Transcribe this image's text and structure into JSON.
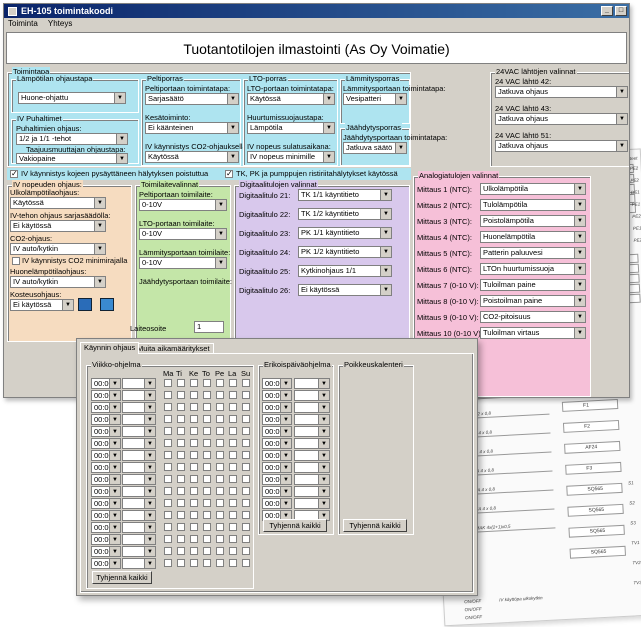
{
  "window": {
    "title": "EH-105 toimintakoodi"
  },
  "menu": [
    "Toiminta",
    "Yhteys"
  ],
  "banner": "Tuotantotilojen ilmastointi (As Oy Voimatie)",
  "toimintapa": {
    "title": "Toimintapa",
    "lampo": {
      "title": "Lämpötilan ohjaustapa",
      "value": "Huone-ohjattu"
    },
    "ivp": {
      "title": "IV Puhaltimet",
      "l1": "Puhaltimien ohjaus:",
      "v1": "1/2 ja 1/1 -tehot",
      "l2": "Taajuusmuuttajan ohjaustapa:",
      "v2": "Vakiopaine"
    },
    "pelti": {
      "title": "Peltiporras",
      "l1": "Peltiportaan toimintatapa:",
      "v1": "Sarjasäätö",
      "l2": "Kesätoiminto:",
      "v2": "Ei käänteinen",
      "l3": "IV käynnistys CO2-ohjauksella:",
      "v3": "Käytössä"
    },
    "lto": {
      "title": "LTO-porras",
      "l1": "LTO-portaan toimintatapa:",
      "v1": "Käytössä",
      "l2": "Huurtumissuojaustapa:",
      "v2": "Lämpötila",
      "l3": "IV nopeus sulatusaikana:",
      "v3": "IV nopeus minimille"
    },
    "lammitys": {
      "title": "Lämmitysporras",
      "l1": "Lämmitysportaan toimintatapa:",
      "v1": "Vesipatteri"
    },
    "jaahdytys": {
      "title": "Jäähdytysporras",
      "l1": "Jäähdytysportaan toimintatapa:",
      "v1": "Jatkuva säätö"
    },
    "check1": "IV käynnistys kojeen pysäyttäneen hälytyksen poistuttua",
    "check2": "TK, PK ja pumppujen ristiriitahälytykset käytössä"
  },
  "vac": {
    "title": "24VAC lähtöjen valinnat",
    "items": [
      {
        "label": "24 VAC lähtö 42:",
        "value": "Jatkuva ohjaus"
      },
      {
        "label": "24 VAC lähtö 43:",
        "value": "Jatkuva ohjaus"
      },
      {
        "label": "24 VAC lähtö 51:",
        "value": "Jatkuva ohjaus"
      }
    ]
  },
  "ivnop": {
    "title": "IV nopeuden ohjaus:",
    "l1": "Ulkolämpötilaohjaus:",
    "v1": "Käytössä",
    "l2": "IV-tehon ohjaus sarjasäädölla:",
    "v2": "Ei käytössä",
    "l3": "CO2-ohjaus:",
    "v3": "IV auto/kytkin",
    "c1": "IV käynnistys CO2 minimirajalla",
    "l4": "Huonelämpötilaohjaus:",
    "v4": "IV auto/kytkin",
    "l5": "Kosteusohjaus:",
    "v5": "Ei käytössä"
  },
  "toimilaite": {
    "title": "Toimilaitevalinnat",
    "items": [
      {
        "label": "Peltiportaan toimilaite:",
        "value": "0-10V"
      },
      {
        "label": "LTO-portaan toimilaite:",
        "value": "0-10V"
      },
      {
        "label": "Lämmitysportaan toimilaite:",
        "value": "0-10V"
      },
      {
        "label": "Jäähdytysportaan toimilaite:",
        "value": ""
      }
    ]
  },
  "digitaali": {
    "title": "Digitaalitulojen valinnat",
    "items": [
      {
        "label": "Digitaalitulo 21:",
        "value": "TK 1/1 käyntitieto"
      },
      {
        "label": "Digitaalitulo 22:",
        "value": "TK 1/2 käyntitieto"
      },
      {
        "label": "Digitaalitulo 23:",
        "value": "PK 1/1 käyntitieto"
      },
      {
        "label": "Digitaalitulo 24:",
        "value": "PK 1/2 käyntitieto"
      },
      {
        "label": "Digitaalitulo 25:",
        "value": "Kytkinohjaus 1/1"
      },
      {
        "label": "Digitaalitulo 26:",
        "value": "Ei käytössä"
      }
    ]
  },
  "analogia": {
    "title": "Analogiatulojen valinnat",
    "items": [
      {
        "label": "Mittaus 1 (NTC):",
        "value": "Ulkolämpötila"
      },
      {
        "label": "Mittaus 2 (NTC):",
        "value": "Tulolämpötila"
      },
      {
        "label": "Mittaus 3 (NTC):",
        "value": "Poistolämpötila"
      },
      {
        "label": "Mittaus 4 (NTC):",
        "value": "Huonelämpötila"
      },
      {
        "label": "Mittaus 5 (NTC):",
        "value": "Patterin paluuvesi"
      },
      {
        "label": "Mittaus 6 (NTC):",
        "value": "LTOn huurtumissuoja"
      },
      {
        "label": "Mittaus 7 (0-10 V):",
        "value": "Tuloilman paine"
      },
      {
        "label": "Mittaus 8 (0-10 V):",
        "value": "Poistoilman paine"
      },
      {
        "label": "Mittaus 9 (0-10 V):",
        "value": "CO2-pitoisuus"
      },
      {
        "label": "Mittaus 10 (0-10 V):",
        "value": "Tuloilman virtaus"
      }
    ]
  },
  "laiteosoite": {
    "label": "Laiteosoite",
    "value": "1"
  },
  "schedule": {
    "tabs": [
      "Käynnin ohjaus",
      "Muita aikamääritykset"
    ],
    "viikko": "Viikko-ohjelma",
    "days": [
      "Ma",
      "Ti",
      "Ke",
      "To",
      "Pe",
      "La",
      "Su"
    ],
    "time": "00:00",
    "erikois": "Erikoispäiväohjelma",
    "poikkeus": "Poikkeuskalenteri",
    "clear_all": "Tyhjennä kaikki",
    "clear": "Tyhjennä kaikki"
  },
  "sheet": {
    "header": "Kenttälaitteet",
    "codes": [
      "TMO",
      "TMO",
      "TMO",
      "TMO",
      "TMO",
      "PEL1000/N",
      "PEL1000/N",
      "SMH/25-N",
      "PEL1000",
      "PEL1000"
    ],
    "tags": [
      "PE2",
      "PE2",
      "DE1",
      "PE1",
      "PE2",
      "PE1",
      "PE2"
    ],
    "flm": [
      "FLMA 2 x 0,8",
      "FLMA 2 x 0,8",
      "FLMA 2 x 0,8",
      "FLMA 2 x 0,8",
      "FLMA 2 x 0,8",
      "FLMA 2 x 0,8",
      "FLMA 2 x 0,8",
      "FLMA 2 x 0,8",
      "FLMA 4 x 0,8",
      "FLMA 4 x 0,8",
      "FLMA 4 x 0,8",
      "FLMA 4 x 0,8",
      "FLMA 4 x 0,8",
      "JAMAK 4x(2+1)x0,5"
    ],
    "right": [
      "HS1",
      "HS2",
      "TF1",
      "TF2",
      "SC1",
      "DK1",
      "F1",
      "F2",
      "AF24",
      "F3",
      "SQ565",
      "SQ565",
      "SQ565",
      "SQ565"
    ],
    "right2": [
      "S1",
      "S2",
      "S3",
      "TV1",
      "TV2",
      "TV3"
    ],
    "bottom": [
      "ON/OFF",
      "ON/OFF",
      "ON/OFF"
    ],
    "btxt": "IV käyttöpa ulkokytkin"
  }
}
